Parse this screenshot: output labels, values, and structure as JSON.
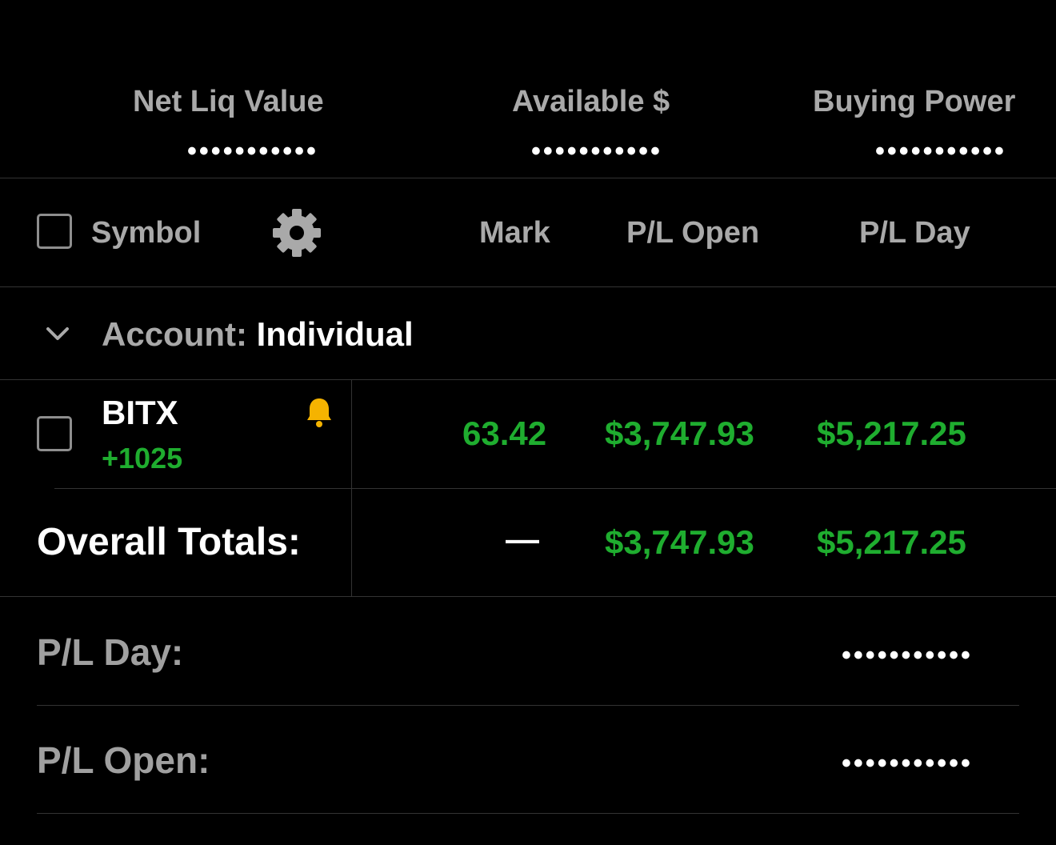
{
  "header": {
    "net_liq_label": "Net Liq Value",
    "net_liq_value": "•••••••••••",
    "available_label": "Available $",
    "available_value": "•••••••••••",
    "buying_power_label": "Buying Power",
    "buying_power_value": "•••••••••••"
  },
  "columns": {
    "symbol": "Symbol",
    "mark": "Mark",
    "pl_open": "P/L Open",
    "pl_day": "P/L Day"
  },
  "account": {
    "label": "Account:",
    "name": "Individual"
  },
  "positions": [
    {
      "symbol": "BITX",
      "quantity": "+1025",
      "mark": "63.42",
      "pl_open": "$3,747.93",
      "pl_day": "$5,217.25",
      "alert_icon": "bell-icon"
    }
  ],
  "totals": {
    "label": "Overall Totals:",
    "mark": "—",
    "pl_open": "$3,747.93",
    "pl_day": "$5,217.25"
  },
  "summary": {
    "pl_day_label": "P/L Day:",
    "pl_day_value": "•••••••••••",
    "pl_open_label": "P/L Open:",
    "pl_open_value": "•••••••••••"
  },
  "colors": {
    "background": "#000000",
    "positive": "#1fad2f",
    "alert": "#f5b300",
    "muted_text": "#a9a9a9"
  }
}
